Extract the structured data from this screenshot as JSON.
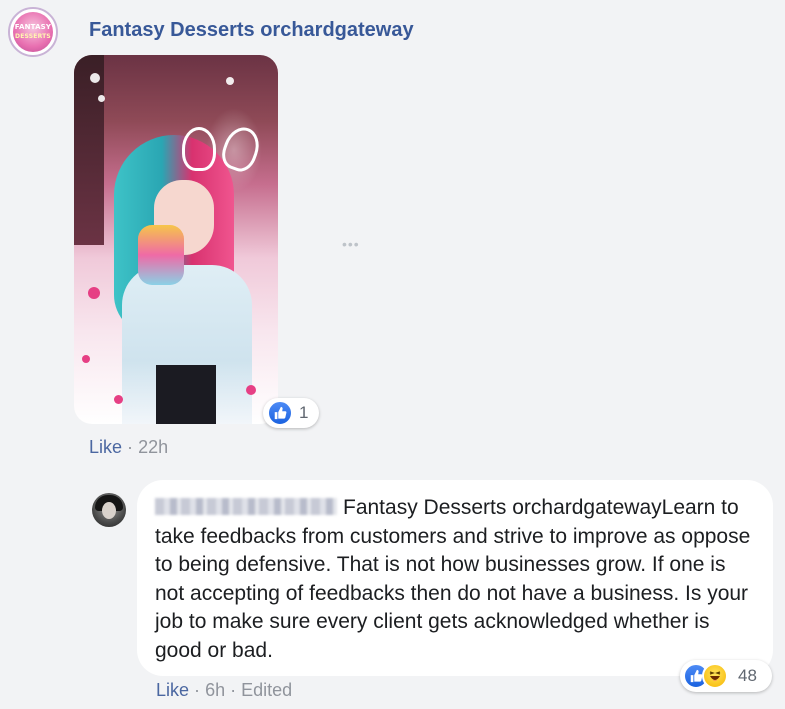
{
  "post_comment": {
    "author": "Fantasy Desserts orchardgateway",
    "avatar_icon": "fantasy-desserts-logo-icon",
    "logo_text_top": "FANTASY",
    "logo_text_bottom": "DESSERTS",
    "image_icon": "photo-girl-with-dessert",
    "reaction": {
      "icon": "like-icon",
      "count": "1"
    },
    "actions": {
      "like_label": "Like",
      "separator": "·",
      "time": "22h"
    },
    "more_icon": "more-options-icon",
    "more_text": "•••"
  },
  "reply": {
    "author_blurred": true,
    "avatar_icon": "user-avatar-icon",
    "mention": "Fantasy Desserts orchardgateway",
    "text": "Learn to take feedbacks from customers and strive to improve as oppose to being defensive. That is not how businesses grow. If one is not accepting of feedbacks then do not have a business. Is your job to make sure every client gets acknowledged whether is good or bad.",
    "reactions": {
      "icons": [
        "like-icon",
        "haha-icon"
      ],
      "count": "48"
    },
    "actions": {
      "like_label": "Like",
      "separator": "·",
      "time": "6h",
      "edited_label": "Edited"
    }
  },
  "colors": {
    "background": "#f2f3f5",
    "name_link": "#385898",
    "action_link": "#4b67a1",
    "meta_gray": "#90949c",
    "like_blue": "#1a62e0",
    "haha_yellow": "#f7b500"
  }
}
